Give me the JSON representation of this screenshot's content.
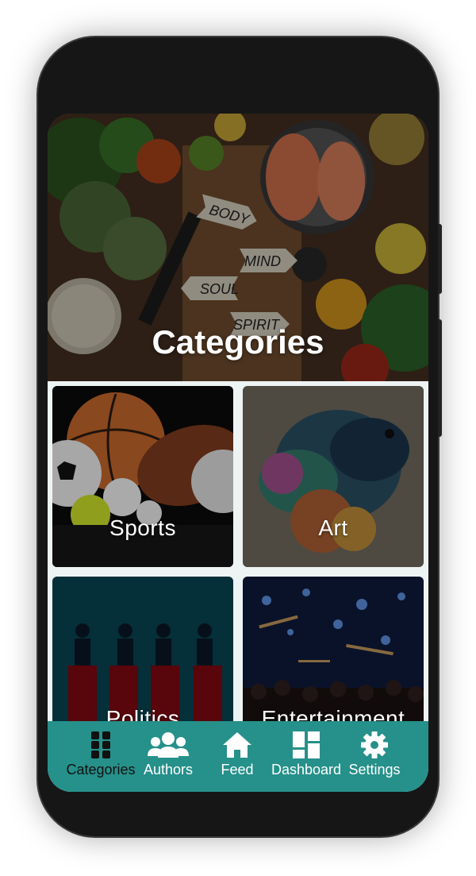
{
  "header": {
    "title": "Categories"
  },
  "hero_art": {
    "arrow_words": [
      "BODY",
      "MIND",
      "SOUL",
      "SPIRIT"
    ]
  },
  "categories": [
    {
      "label": "Sports"
    },
    {
      "label": "Art"
    },
    {
      "label": "Politics"
    },
    {
      "label": "Entertainment"
    }
  ],
  "nav": {
    "items": [
      {
        "label": "Categories",
        "icon": "grid-icon",
        "active": true
      },
      {
        "label": "Authors",
        "icon": "users-icon",
        "active": false
      },
      {
        "label": "Feed",
        "icon": "home-icon",
        "active": false
      },
      {
        "label": "Dashboard",
        "icon": "dashboard-icon",
        "active": false
      },
      {
        "label": "Settings",
        "icon": "gear-icon",
        "active": false
      }
    ]
  },
  "colors": {
    "nav_bg": "#26908a",
    "active_nav": "#111111",
    "inactive_nav": "#ffffff",
    "screen_bg": "#eef3f3"
  }
}
